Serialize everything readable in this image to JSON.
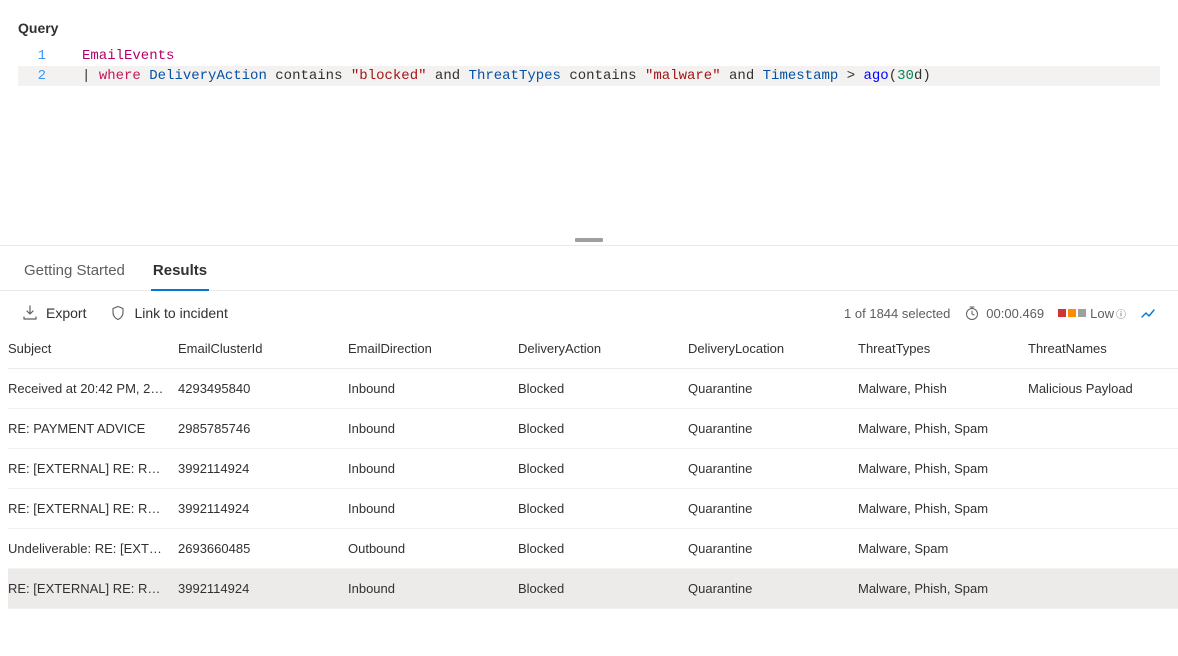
{
  "query": {
    "title": "Query",
    "lines": [
      {
        "n": "1"
      },
      {
        "n": "2"
      }
    ],
    "tokens": {
      "emailEvents": "EmailEvents",
      "pipe": "|",
      "where": "where",
      "deliveryAction": "DeliveryAction",
      "contains": "contains",
      "blocked": "\"blocked\"",
      "and": "and",
      "threatTypes": "ThreatTypes",
      "malware": "\"malware\"",
      "timestamp": "Timestamp",
      "gt": ">",
      "ago": "ago",
      "lparen": "(",
      "thirty": "30",
      "d": "d",
      "rparen": ")"
    }
  },
  "tabs": {
    "gettingStarted": "Getting Started",
    "results": "Results"
  },
  "toolbar": {
    "export": "Export",
    "linkToIncident": "Link to incident"
  },
  "status": {
    "selection": "1 of 1844 selected",
    "elapsed": "00:00.469",
    "severityLabel": "Low"
  },
  "columns": {
    "subject": "Subject",
    "emailClusterId": "EmailClusterId",
    "emailDirection": "EmailDirection",
    "deliveryAction": "DeliveryAction",
    "deliveryLocation": "DeliveryLocation",
    "threatTypes": "ThreatTypes",
    "threatNames": "ThreatNames"
  },
  "rows": [
    {
      "subject": "Received at 20:42 PM, 2…",
      "emailClusterId": "4293495840",
      "emailDirection": "Inbound",
      "deliveryAction": "Blocked",
      "deliveryLocation": "Quarantine",
      "threatTypes": "Malware, Phish",
      "threatNames": "Malicious Payload"
    },
    {
      "subject": "RE: PAYMENT ADVICE",
      "emailClusterId": "2985785746",
      "emailDirection": "Inbound",
      "deliveryAction": "Blocked",
      "deliveryLocation": "Quarantine",
      "threatTypes": "Malware, Phish, Spam",
      "threatNames": ""
    },
    {
      "subject": "RE: [EXTERNAL] RE: RE: …",
      "emailClusterId": "3992114924",
      "emailDirection": "Inbound",
      "deliveryAction": "Blocked",
      "deliveryLocation": "Quarantine",
      "threatTypes": "Malware, Phish, Spam",
      "threatNames": ""
    },
    {
      "subject": "RE: [EXTERNAL] RE: RE: …",
      "emailClusterId": "3992114924",
      "emailDirection": "Inbound",
      "deliveryAction": "Blocked",
      "deliveryLocation": "Quarantine",
      "threatTypes": "Malware, Phish, Spam",
      "threatNames": ""
    },
    {
      "subject": "Undeliverable: RE: [EXTE…",
      "emailClusterId": "2693660485",
      "emailDirection": "Outbound",
      "deliveryAction": "Blocked",
      "deliveryLocation": "Quarantine",
      "threatTypes": "Malware, Spam",
      "threatNames": ""
    },
    {
      "subject": "RE: [EXTERNAL] RE: RE: …",
      "emailClusterId": "3992114924",
      "emailDirection": "Inbound",
      "deliveryAction": "Blocked",
      "deliveryLocation": "Quarantine",
      "threatTypes": "Malware, Phish, Spam",
      "threatNames": ""
    }
  ]
}
